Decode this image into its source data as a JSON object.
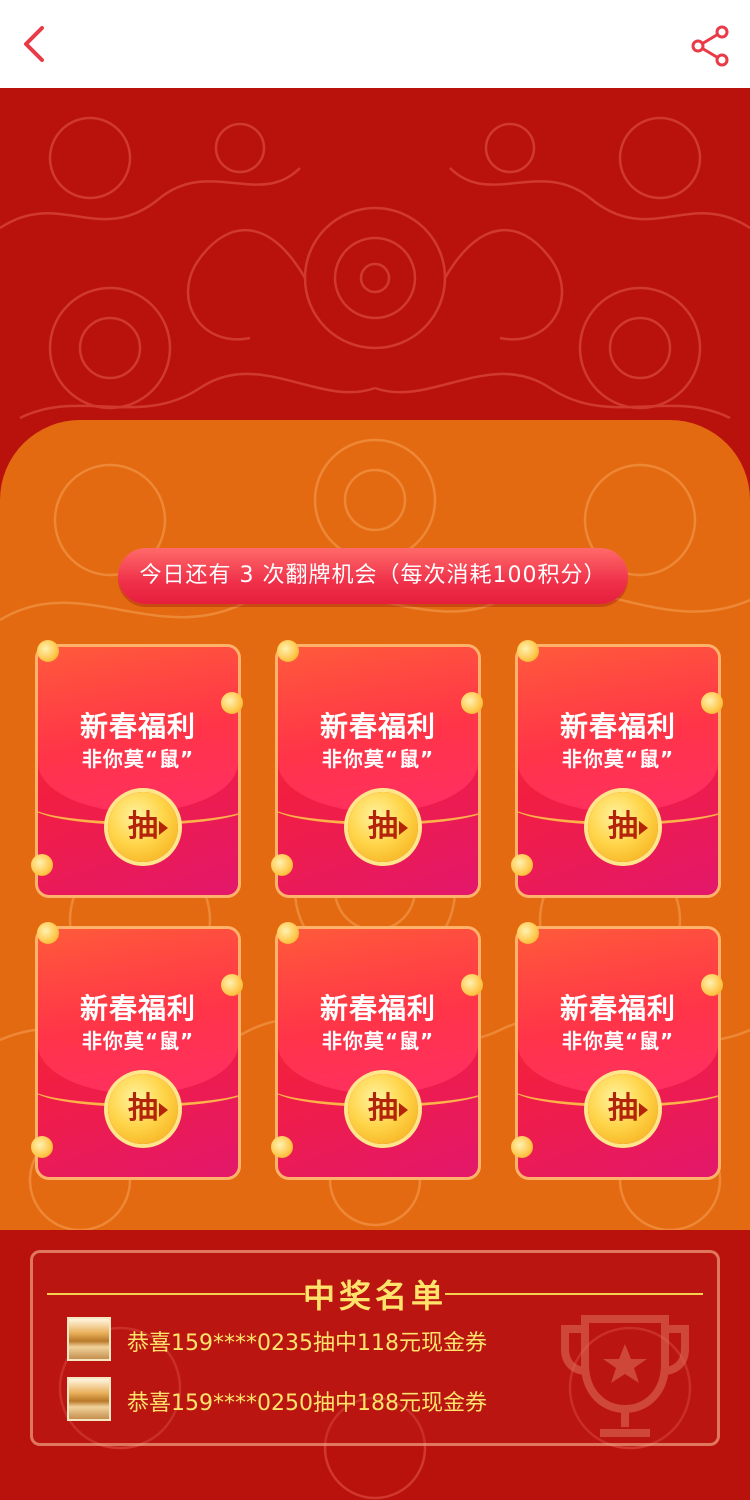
{
  "header": {
    "back_icon": "chevron-left-icon",
    "share_icon": "share-icon",
    "accent_color": "#e93a48"
  },
  "chance": {
    "text": "今日还有 3 次翻牌机会（每次消耗100积分）"
  },
  "cards": [
    {
      "title": "新春福利",
      "subtitle": "非你莫“鼠”",
      "button": "抽"
    },
    {
      "title": "新春福利",
      "subtitle": "非你莫“鼠”",
      "button": "抽"
    },
    {
      "title": "新春福利",
      "subtitle": "非你莫“鼠”",
      "button": "抽"
    },
    {
      "title": "新春福利",
      "subtitle": "非你莫“鼠”",
      "button": "抽"
    },
    {
      "title": "新春福利",
      "subtitle": "非你莫“鼠”",
      "button": "抽"
    },
    {
      "title": "新春福利",
      "subtitle": "非你莫“鼠”",
      "button": "抽"
    }
  ],
  "winners": {
    "title": "中奖名单",
    "items": [
      {
        "text": "恭喜159****0235抽中118元现金券"
      },
      {
        "text": "恭喜159****0250抽中188元现金券"
      }
    ],
    "decor_icon": "trophy-icon"
  },
  "colors": {
    "background_red": "#b9120c",
    "panel_orange": "#e46a12",
    "gold_text": "#ffe36b"
  }
}
